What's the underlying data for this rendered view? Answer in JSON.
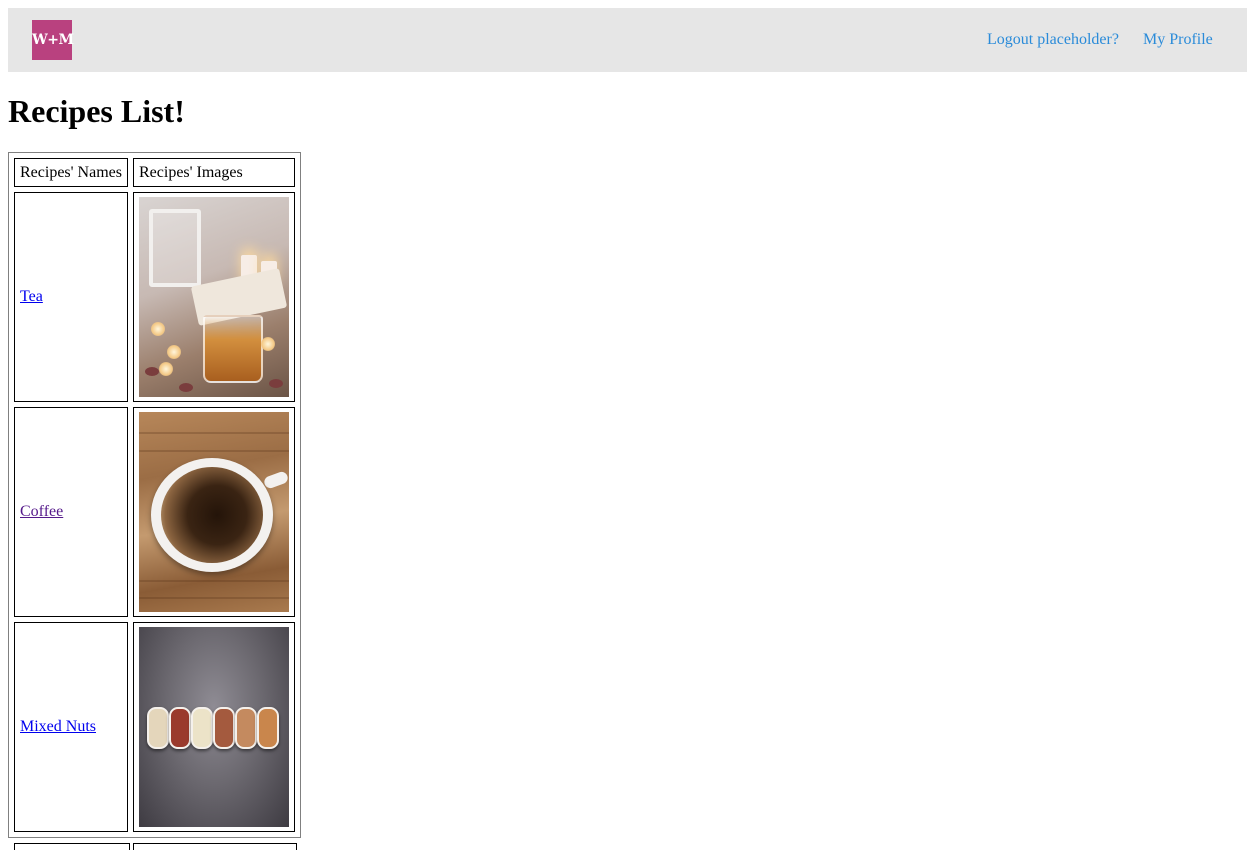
{
  "navbar": {
    "logo_text": "W+M",
    "logo_color": "#b9417f",
    "logout_label": "Logout placeholder?",
    "profile_label": "My Profile",
    "link_color": "#2a8bd9",
    "background": "#e6e6e6"
  },
  "page": {
    "title": "Recipes List!"
  },
  "table": {
    "headers": [
      "Recipes' Names",
      "Recipes' Images"
    ],
    "rows": [
      {
        "name": "Tea",
        "image": "tea-with-candles-photo",
        "visited": false
      },
      {
        "name": "Coffee",
        "image": "coffee-cup-photo",
        "visited": true
      },
      {
        "name": "Mixed Nuts",
        "image": "mixed-nuts-bowls-photo",
        "visited": false
      }
    ]
  }
}
